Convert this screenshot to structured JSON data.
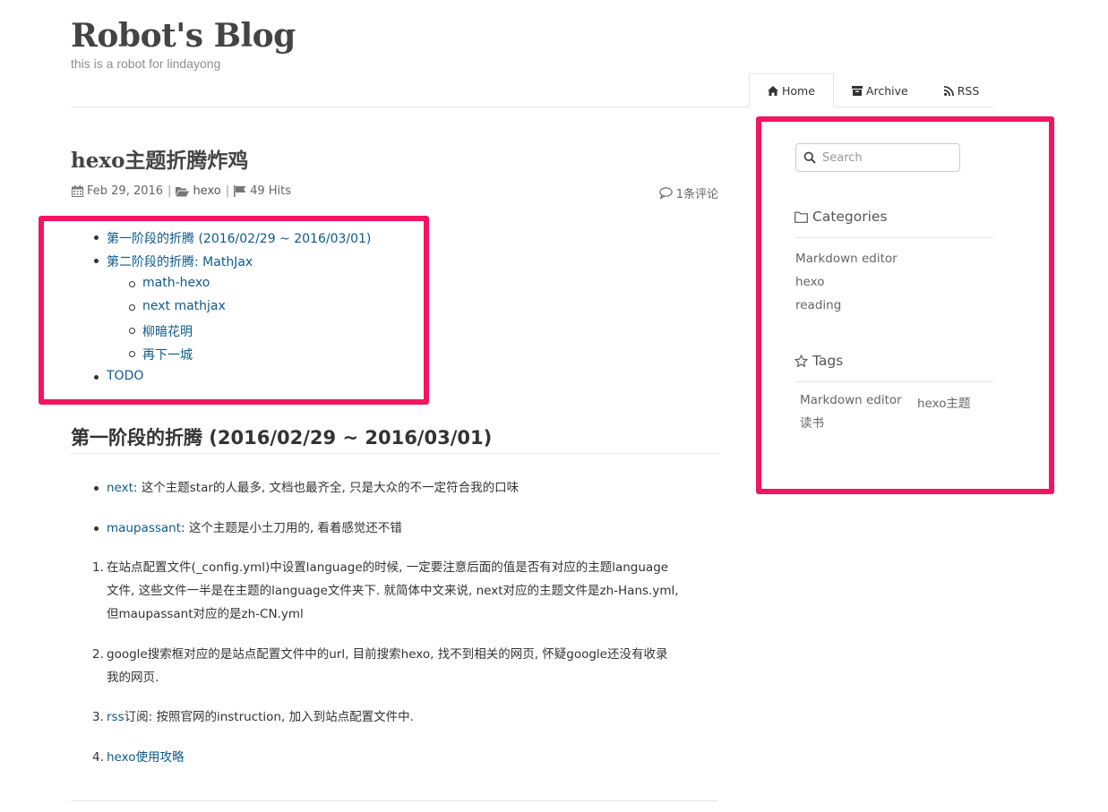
{
  "header": {
    "blog_title": "Robot's Blog",
    "subtitle": "this is a robot for lindayong"
  },
  "nav": {
    "items": [
      {
        "label": "Home",
        "icon": "home-icon",
        "active": true
      },
      {
        "label": "Archive",
        "icon": "archive-icon",
        "active": false
      },
      {
        "label": "RSS",
        "icon": "rss-icon",
        "active": false
      }
    ]
  },
  "post": {
    "title": "hexo主题折腾炸鸡",
    "date": "Feb 29, 2016",
    "category": "hexo",
    "hits": "49 Hits",
    "comments": "1条评论",
    "separator": "|"
  },
  "toc": {
    "items": [
      {
        "label": "第一阶段的折腾 (2016/02/29 ~ 2016/03/01)"
      },
      {
        "label": "第二阶段的折腾: MathJax"
      },
      {
        "label": "math-hexo"
      },
      {
        "label": "next mathjax"
      },
      {
        "label": "柳暗花明"
      },
      {
        "label": "再下一城"
      },
      {
        "label": "TODO"
      }
    ]
  },
  "section": {
    "title": "第一阶段的折腾 (2016/02/29 ~ 2016/03/01)",
    "bullets": [
      {
        "link": "next",
        "text": ": 这个主题star的人最多, 文档也最齐全, 只是大众的不一定符合我的口味"
      },
      {
        "link": "maupassant",
        "text": ": 这个主题是小土刀用的, 看着感觉还不错"
      }
    ],
    "ordered": [
      {
        "number": "1.",
        "lines": [
          "在站点配置文件(_config.yml)中设置language的时候, 一定要注意后面的值是否有对应的主题language",
          "文件, 这些文件一半是在主题的language文件夹下. 就简体中文来说, next对应的主题文件是zh-Hans.yml,",
          "但maupassant对应的是zh-CN.yml"
        ]
      },
      {
        "number": "2.",
        "lines": [
          "google搜索框对应的是站点配置文件中的url, 目前搜索hexo, 找不到相关的网页, 怀疑google还没有收录",
          "我的网页."
        ]
      },
      {
        "number": "3.",
        "link": "rss",
        "text": "订阅: 按照官网的instruction, 加入到站点配置文件中."
      },
      {
        "number": "4.",
        "link": "hexo使用攻略"
      }
    ]
  },
  "sidebar": {
    "search_placeholder": "Search",
    "categories_title": "Categories",
    "categories": [
      "Markdown editor",
      "hexo",
      "reading"
    ],
    "tags_title": "Tags",
    "tags": [
      "Markdown editor",
      "hexo主题",
      "读书"
    ]
  },
  "colors": {
    "link": "#0e5a8a",
    "highlight_border": "#f5145f",
    "text": "#333333"
  }
}
